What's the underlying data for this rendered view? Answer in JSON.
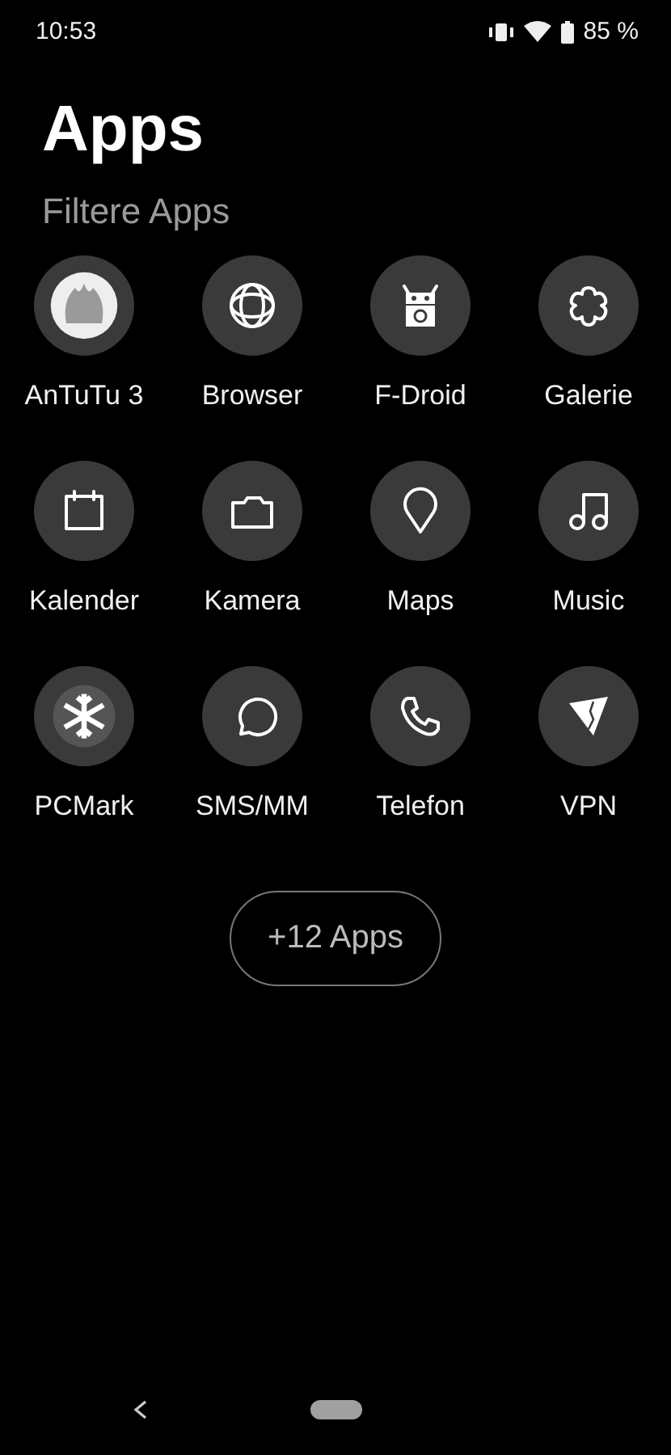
{
  "status_bar": {
    "time": "10:53",
    "battery": "85 %"
  },
  "title": "Apps",
  "search": {
    "placeholder": "Filtere Apps"
  },
  "apps": [
    {
      "label": "AnTuTu 3"
    },
    {
      "label": "Browser"
    },
    {
      "label": "F-Droid"
    },
    {
      "label": "Galerie"
    },
    {
      "label": "Kalender"
    },
    {
      "label": "Kamera"
    },
    {
      "label": "Maps"
    },
    {
      "label": "Music"
    },
    {
      "label": "PCMark"
    },
    {
      "label": "SMS/MM"
    },
    {
      "label": "Telefon"
    },
    {
      "label": "VPN"
    }
  ],
  "more_button": "+12 Apps"
}
